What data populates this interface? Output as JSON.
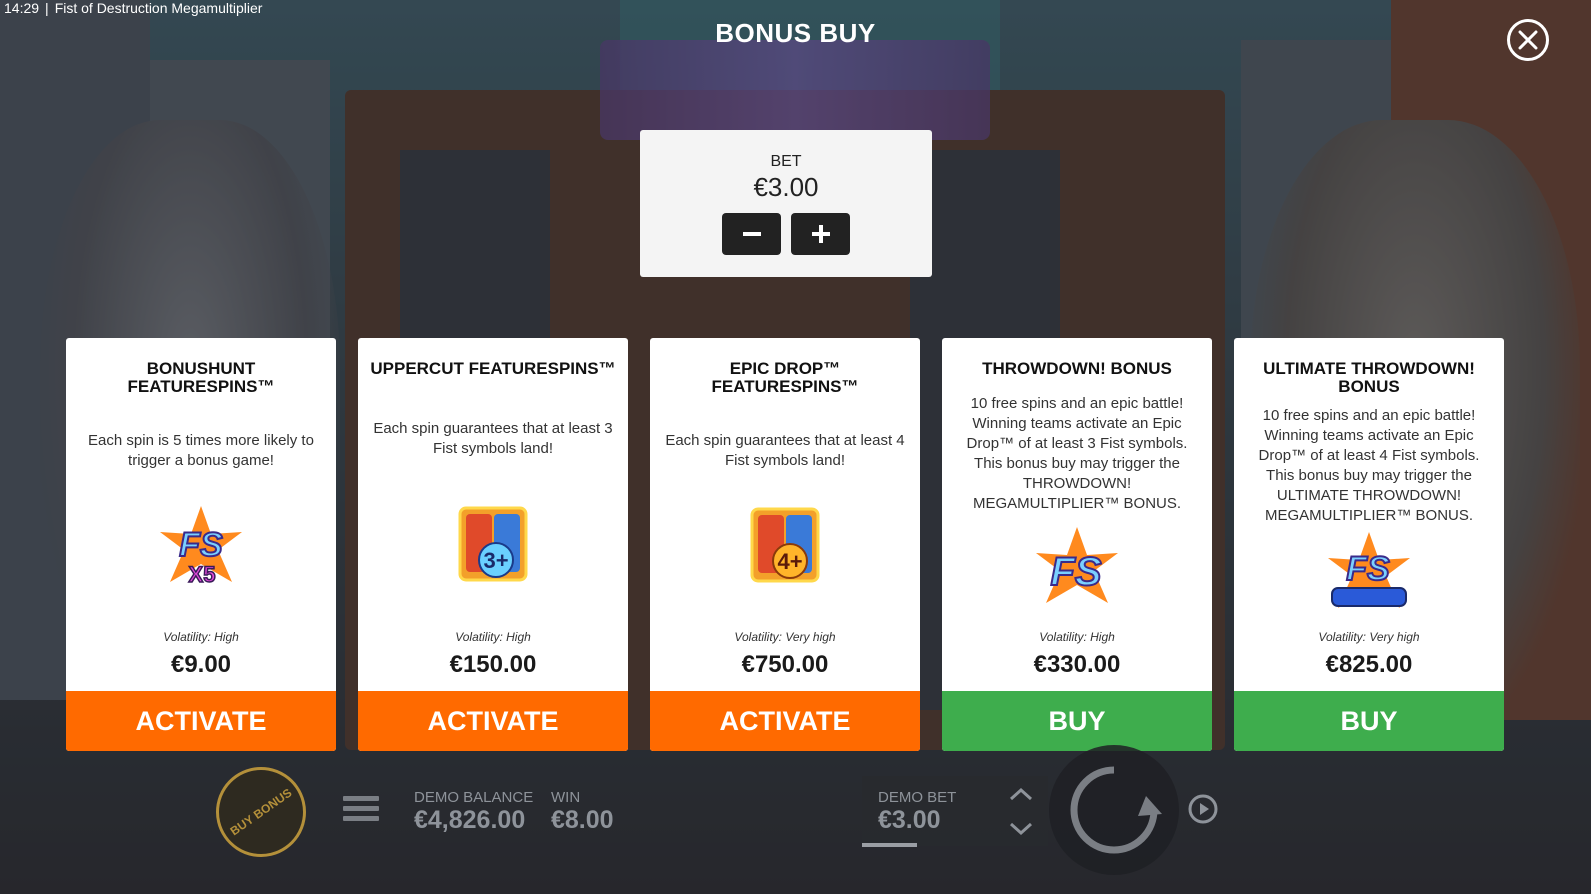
{
  "status_bar": {
    "time": "14:29",
    "separator": "|",
    "game_title": "Fist of Destruction Megamultiplier"
  },
  "dialog": {
    "title": "BONUS BUY",
    "close_icon": "close-icon"
  },
  "bet": {
    "label": "BET",
    "value": "€3.00",
    "decrease_icon": "minus-icon",
    "increase_icon": "plus-icon"
  },
  "cards": [
    {
      "title_line1": "BONUSHUNT",
      "title_line2": "FEATURESPINS™",
      "description": "Each spin is 5 times more likely to trigger a bonus game!",
      "icon": "fs-x5-icon",
      "volatility": "Volatility: High",
      "price": "€9.00",
      "button": "ACTIVATE",
      "button_color": "#ff6a00"
    },
    {
      "title_line1": "UPPERCUT FEATURESPINS™",
      "title_line2": "",
      "description": "Each spin guarantees that at least 3 Fist symbols land!",
      "icon": "fist-3-plus-icon",
      "volatility": "Volatility: High",
      "price": "€150.00",
      "button": "ACTIVATE",
      "button_color": "#ff6a00"
    },
    {
      "title_line1": "EPIC DROP™",
      "title_line2": "FEATURESPINS™",
      "description": "Each spin guarantees that at least 4 Fist symbols land!",
      "icon": "fist-4-plus-icon",
      "volatility": "Volatility: Very high",
      "price": "€750.00",
      "button": "ACTIVATE",
      "button_color": "#ff6a00"
    },
    {
      "title_line1": "THROWDOWN! BONUS",
      "title_line2": "",
      "description": "10 free spins and an epic battle! Winning teams activate an Epic Drop™ of at least 3 Fist symbols. This bonus buy may trigger the THROWDOWN! MEGAMULTIPLIER™ BONUS.",
      "icon": "fs-icon",
      "volatility": "Volatility: High",
      "price": "€330.00",
      "button": "BUY",
      "button_color": "#3ead4d"
    },
    {
      "title_line1": "ULTIMATE THROWDOWN!",
      "title_line2": "BONUS",
      "description": "10 free spins and an epic battle! Winning teams activate an Epic Drop™ of at least 4 Fist symbols. This bonus buy may trigger the ULTIMATE THROWDOWN! MEGAMULTIPLIER™ BONUS.",
      "icon": "fs-ultimate-icon",
      "volatility": "Volatility: Very high",
      "price": "€825.00",
      "button": "BUY",
      "button_color": "#3ead4d"
    }
  ],
  "hud": {
    "buy_bonus_label": "BUY BONUS",
    "demo_balance_label": "DEMO BALANCE",
    "demo_balance_value": "€4,826.00",
    "win_label": "WIN",
    "win_value": "€8.00",
    "demo_bet_label": "DEMO BET",
    "demo_bet_value": "€3.00"
  }
}
